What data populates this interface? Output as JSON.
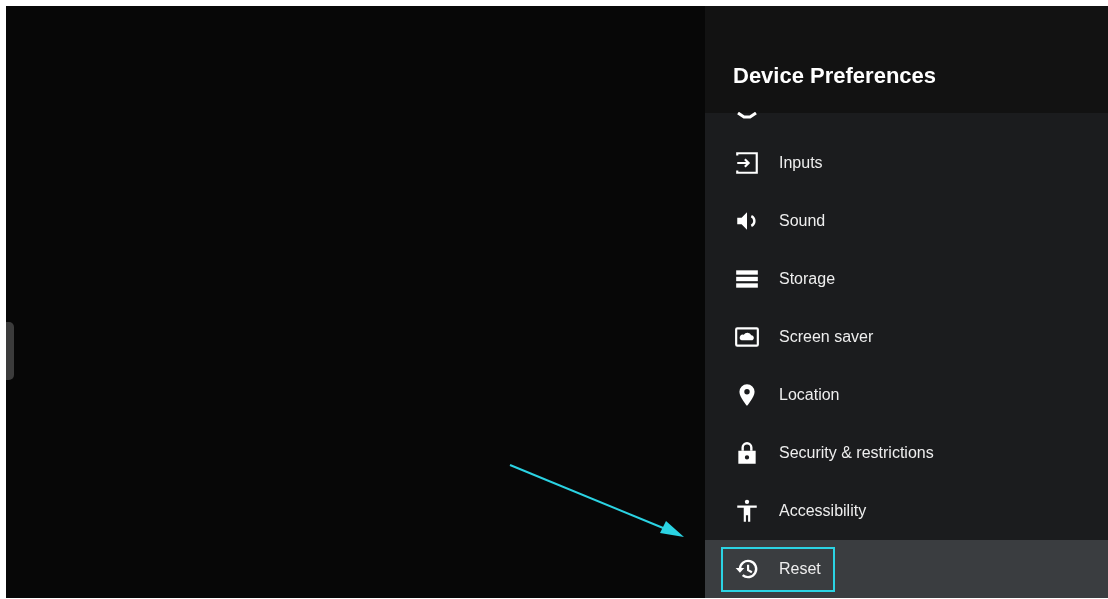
{
  "panel": {
    "title": "Device Preferences",
    "items": [
      {
        "label": "Inputs",
        "kind": "inputs",
        "selected": false
      },
      {
        "label": "Sound",
        "kind": "sound",
        "selected": false
      },
      {
        "label": "Storage",
        "kind": "storage",
        "selected": false
      },
      {
        "label": "Screen saver",
        "kind": "screensaver",
        "selected": false
      },
      {
        "label": "Location",
        "kind": "location",
        "selected": false
      },
      {
        "label": "Security & restrictions",
        "kind": "lock",
        "selected": false
      },
      {
        "label": "Accessibility",
        "kind": "accessibility",
        "selected": false
      },
      {
        "label": "Reset",
        "kind": "reset",
        "selected": true
      }
    ]
  }
}
